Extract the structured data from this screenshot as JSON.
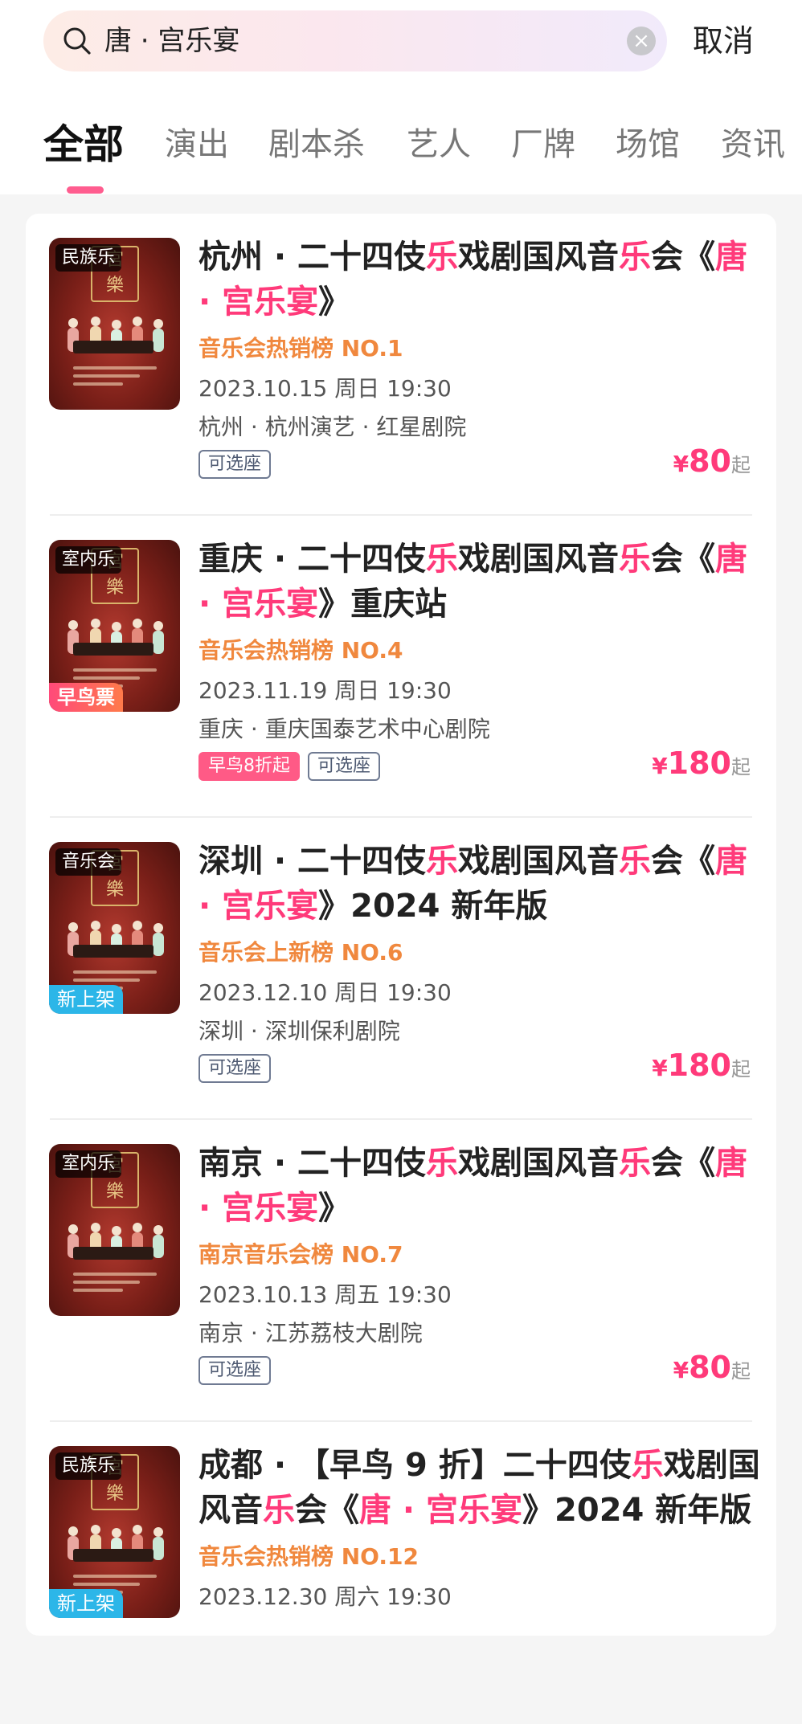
{
  "search": {
    "query": "唐 · 宫乐宴",
    "clear_icon": "close-circle-icon",
    "search_icon": "search-icon"
  },
  "header": {
    "cancel_label": "取消"
  },
  "tabs": [
    {
      "label": "全部",
      "active": true
    },
    {
      "label": "演出"
    },
    {
      "label": "剧本杀"
    },
    {
      "label": "艺人"
    },
    {
      "label": "厂牌"
    },
    {
      "label": "场馆"
    },
    {
      "label": "资讯"
    }
  ],
  "results": [
    {
      "poster_tag": "民族乐",
      "poster_badge": "",
      "title_parts": [
        "杭州 · 二十四伎",
        "乐",
        "戏剧国风音",
        "乐",
        "会",
        "《",
        "唐 · 宫乐宴",
        "》",
        ""
      ],
      "rank": "音乐会热销榜 NO.1",
      "date": "2023.10.15 周日 19:30",
      "venue": "杭州 · 杭州演艺 · 红星剧院",
      "tags": [
        "可选座"
      ],
      "early_tag": "",
      "price_currency": "¥",
      "price_value": "80",
      "price_suffix": "起"
    },
    {
      "poster_tag": "室内乐",
      "poster_badge": "早鸟票",
      "title_parts": [
        "重庆 · 二十四伎",
        "乐",
        "戏剧国风音",
        "乐",
        "会",
        "《",
        "唐 · 宫乐宴",
        "》",
        "重庆站"
      ],
      "rank": "音乐会热销榜 NO.4",
      "date": "2023.11.19 周日 19:30",
      "venue": "重庆 · 重庆国泰艺术中心剧院",
      "tags": [
        "可选座"
      ],
      "early_tag": "早鸟8折起",
      "price_currency": "¥",
      "price_value": "180",
      "price_suffix": "起"
    },
    {
      "poster_tag": "音乐会",
      "poster_badge": "新上架",
      "title_parts": [
        "深圳 · 二十四伎",
        "乐",
        "戏剧国风音",
        "乐",
        "会",
        "《",
        "唐 · 宫乐宴",
        "》",
        "2024 新年版"
      ],
      "rank": "音乐会上新榜 NO.6",
      "date": "2023.12.10 周日 19:30",
      "venue": "深圳 · 深圳保利剧院",
      "tags": [
        "可选座"
      ],
      "early_tag": "",
      "price_currency": "¥",
      "price_value": "180",
      "price_suffix": "起"
    },
    {
      "poster_tag": "室内乐",
      "poster_badge": "",
      "title_parts": [
        "南京 · 二十四伎",
        "乐",
        "戏剧国风音",
        "乐",
        "会",
        "《",
        "唐 · 宫乐宴",
        "》",
        ""
      ],
      "rank": "南京音乐会榜 NO.7",
      "date": "2023.10.13 周五 19:30",
      "venue": "南京 · 江苏荔枝大剧院",
      "tags": [
        "可选座"
      ],
      "early_tag": "",
      "price_currency": "¥",
      "price_value": "80",
      "price_suffix": "起"
    },
    {
      "poster_tag": "民族乐",
      "poster_badge": "新上架",
      "title_parts": [
        "成都 · 【早鸟 9 折】二十四伎",
        "乐",
        "戏剧国风音",
        "乐",
        "会",
        "《",
        "唐 · 宫乐宴",
        "》",
        "2024 新年版"
      ],
      "rank": "音乐会热销榜 NO.12",
      "date": "2023.12.30 周六 19:30",
      "venue": "",
      "tags": [],
      "early_tag": "",
      "price_currency": "",
      "price_value": "",
      "price_suffix": ""
    }
  ],
  "colors": {
    "accent": "#ff3a7a",
    "rank": "#f0883e",
    "new_badge": "#2cb6e8"
  }
}
